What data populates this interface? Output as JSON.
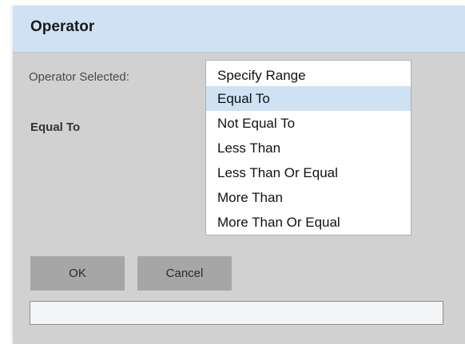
{
  "dialog": {
    "title": "Operator",
    "operator_label": "Operator Selected:",
    "selected_value": "Equal To"
  },
  "operator_list": {
    "items": [
      {
        "label": "Specify Range",
        "selected": false
      },
      {
        "label": "Equal To",
        "selected": true
      },
      {
        "label": "Not Equal To",
        "selected": false
      },
      {
        "label": "Less Than",
        "selected": false
      },
      {
        "label": "Less Than Or Equal",
        "selected": false
      },
      {
        "label": "More Than",
        "selected": false
      },
      {
        "label": "More Than Or Equal",
        "selected": false
      }
    ]
  },
  "buttons": {
    "ok_label": "OK",
    "cancel_label": "Cancel"
  },
  "message_field": {
    "value": ""
  },
  "colors": {
    "title_bar": "#cfe2f3",
    "dialog_body": "#d1d1d1",
    "selected_item": "#cfe2f3",
    "button": "#a6a6a6"
  }
}
